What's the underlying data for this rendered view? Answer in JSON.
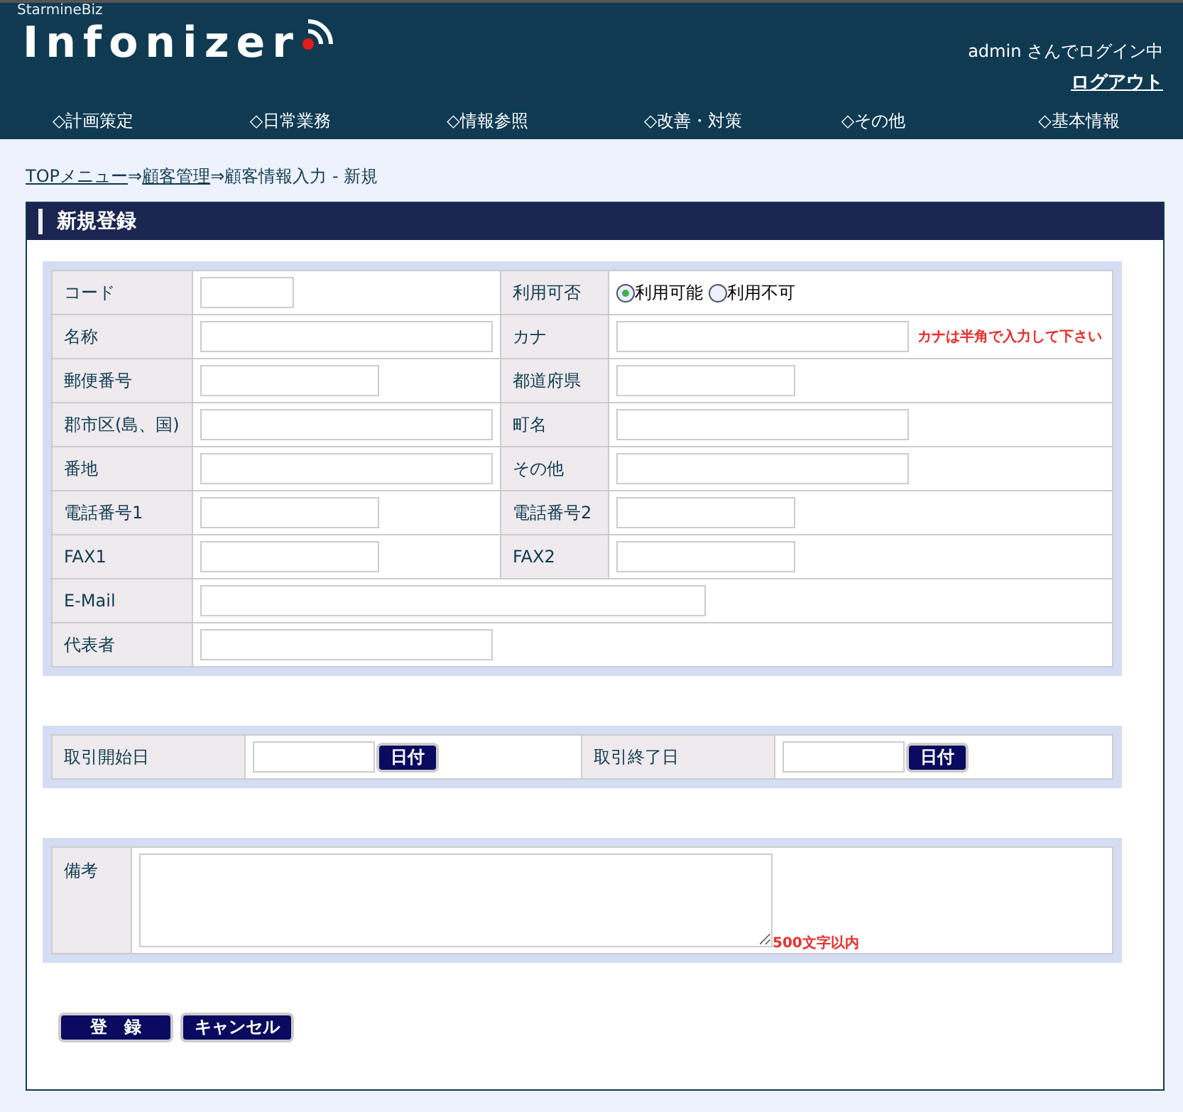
{
  "header": {
    "brand_top": "StarmineBiz",
    "brand": "Infonizer",
    "user_status": "admin さんでログイン中",
    "logout": "ログアウト"
  },
  "nav": [
    "◇計画策定",
    "◇日常業務",
    "◇情報参照",
    "◇改善・対策",
    "◇その他",
    "◇基本情報"
  ],
  "breadcrumb": [
    {
      "label": "TOPメニュー",
      "link": true
    },
    {
      "label": "⇒",
      "link": false
    },
    {
      "label": "顧客管理",
      "link": true
    },
    {
      "label": "⇒顧客情報入力 - 新規",
      "link": false
    }
  ],
  "panel_title": "新規登録",
  "main_rows": [
    {
      "cells": [
        {
          "label": "コード",
          "kind": "tiny"
        },
        {
          "label": "利用可否",
          "kind": "radio",
          "options": [
            {
              "label": "利用可能",
              "selected": true
            },
            {
              "label": "利用不可",
              "selected": false
            }
          ]
        }
      ]
    },
    {
      "cells": [
        {
          "label": "名称",
          "kind": "long"
        },
        {
          "label": "カナ",
          "kind": "long",
          "hint": "カナは半角で入力して下さい"
        }
      ]
    },
    {
      "cells": [
        {
          "label": "郵便番号",
          "kind": "medium"
        },
        {
          "label": "都道府県",
          "kind": "medium"
        }
      ]
    },
    {
      "cells": [
        {
          "label": "郡市区(島、国)",
          "kind": "long"
        },
        {
          "label": "町名",
          "kind": "long"
        }
      ]
    },
    {
      "cells": [
        {
          "label": "番地",
          "kind": "long"
        },
        {
          "label": "その他",
          "kind": "long"
        }
      ]
    },
    {
      "cells": [
        {
          "label": "電話番号1",
          "kind": "medium"
        },
        {
          "label": "電話番号2",
          "kind": "medium"
        }
      ]
    },
    {
      "cells": [
        {
          "label": "FAX1",
          "kind": "medium"
        },
        {
          "label": "FAX2",
          "kind": "medium"
        }
      ]
    },
    {
      "cells": [
        {
          "label": "E-Mail",
          "kind": "wide"
        }
      ]
    },
    {
      "cells": [
        {
          "label": "代表者",
          "kind": "long"
        }
      ]
    }
  ],
  "date_row": [
    {
      "label": "取引開始日",
      "button": "日付"
    },
    {
      "label": "取引終了日",
      "button": "日付"
    }
  ],
  "notes": {
    "label": "備考",
    "hint": "500文字以内"
  },
  "buttons": [
    "登　録",
    "キャンセル"
  ]
}
